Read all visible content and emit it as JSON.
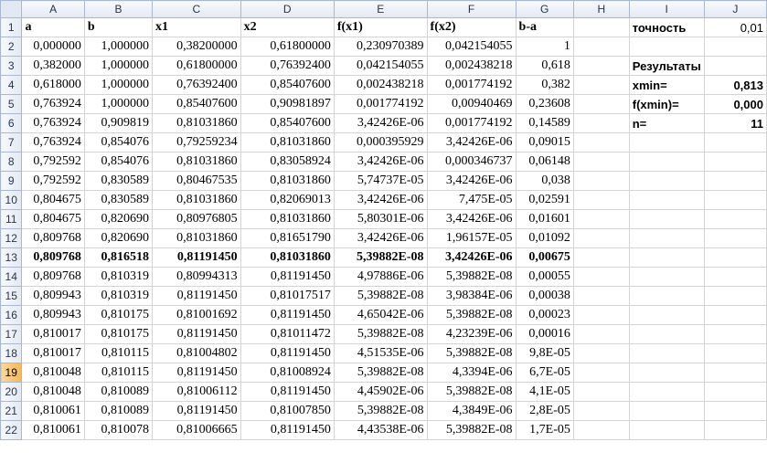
{
  "columns": [
    "A",
    "B",
    "C",
    "D",
    "E",
    "F",
    "G",
    "H",
    "I",
    "J"
  ],
  "headers": [
    "a",
    "b",
    "x1",
    "x2",
    "f(x1)",
    "f(x2)",
    "b-a"
  ],
  "rows": [
    [
      "0,000000",
      "1,000000",
      "0,38200000",
      "0,61800000",
      "0,230970389",
      "0,042154055",
      "1"
    ],
    [
      "0,382000",
      "1,000000",
      "0,61800000",
      "0,76392400",
      "0,042154055",
      "0,002438218",
      "0,618"
    ],
    [
      "0,618000",
      "1,000000",
      "0,76392400",
      "0,85407600",
      "0,002438218",
      "0,001774192",
      "0,382"
    ],
    [
      "0,763924",
      "1,000000",
      "0,85407600",
      "0,90981897",
      "0,001774192",
      "0,00940469",
      "0,23608"
    ],
    [
      "0,763924",
      "0,909819",
      "0,81031860",
      "0,85407600",
      "3,42426E-06",
      "0,001774192",
      "0,14589"
    ],
    [
      "0,763924",
      "0,854076",
      "0,79259234",
      "0,81031860",
      "0,000395929",
      "3,42426E-06",
      "0,09015"
    ],
    [
      "0,792592",
      "0,854076",
      "0,81031860",
      "0,83058924",
      "3,42426E-06",
      "0,000346737",
      "0,06148"
    ],
    [
      "0,792592",
      "0,830589",
      "0,80467535",
      "0,81031860",
      "5,74737E-05",
      "3,42426E-06",
      "0,038"
    ],
    [
      "0,804675",
      "0,830589",
      "0,81031860",
      "0,82069013",
      "3,42426E-06",
      "7,475E-05",
      "0,02591"
    ],
    [
      "0,804675",
      "0,820690",
      "0,80976805",
      "0,81031860",
      "5,80301E-06",
      "3,42426E-06",
      "0,01601"
    ],
    [
      "0,809768",
      "0,820690",
      "0,81031860",
      "0,81651790",
      "3,42426E-06",
      "1,96157E-05",
      "0,01092"
    ],
    [
      "0,809768",
      "0,816518",
      "0,81191450",
      "0,81031860",
      "5,39882E-08",
      "3,42426E-06",
      "0,00675"
    ],
    [
      "0,809768",
      "0,810319",
      "0,80994313",
      "0,81191450",
      "4,97886E-06",
      "5,39882E-08",
      "0,00055"
    ],
    [
      "0,809943",
      "0,810319",
      "0,81191450",
      "0,81017517",
      "5,39882E-08",
      "3,98384E-06",
      "0,00038"
    ],
    [
      "0,809943",
      "0,810175",
      "0,81001692",
      "0,81191450",
      "4,65042E-06",
      "5,39882E-08",
      "0,00023"
    ],
    [
      "0,810017",
      "0,810175",
      "0,81191450",
      "0,81011472",
      "5,39882E-08",
      "4,23239E-06",
      "0,00016"
    ],
    [
      "0,810017",
      "0,810115",
      "0,81004802",
      "0,81191450",
      "4,51535E-06",
      "5,39882E-08",
      "9,8E-05"
    ],
    [
      "0,810048",
      "0,810115",
      "0,81191450",
      "0,81008924",
      "5,39882E-08",
      "4,3394E-06",
      "6,7E-05"
    ],
    [
      "0,810048",
      "0,810089",
      "0,81006112",
      "0,81191450",
      "4,45902E-06",
      "5,39882E-08",
      "4,1E-05"
    ],
    [
      "0,810061",
      "0,810089",
      "0,81191450",
      "0,81007850",
      "5,39882E-08",
      "4,3849E-06",
      "2,8E-05"
    ],
    [
      "0,810061",
      "0,810078",
      "0,81006665",
      "0,81191450",
      "4,43538E-06",
      "5,39882E-08",
      "1,7E-05"
    ]
  ],
  "bold_row_number": 13,
  "selected_row_number": 19,
  "side": {
    "precision_label": "точность",
    "precision_value": "0,01",
    "results_label": "Результаты",
    "xmin_label": "xmin=",
    "xmin_value": "0,813",
    "fxmin_label": "f(xmin)=",
    "fxmin_value": "0,000",
    "n_label": "n=",
    "n_value": "11"
  }
}
